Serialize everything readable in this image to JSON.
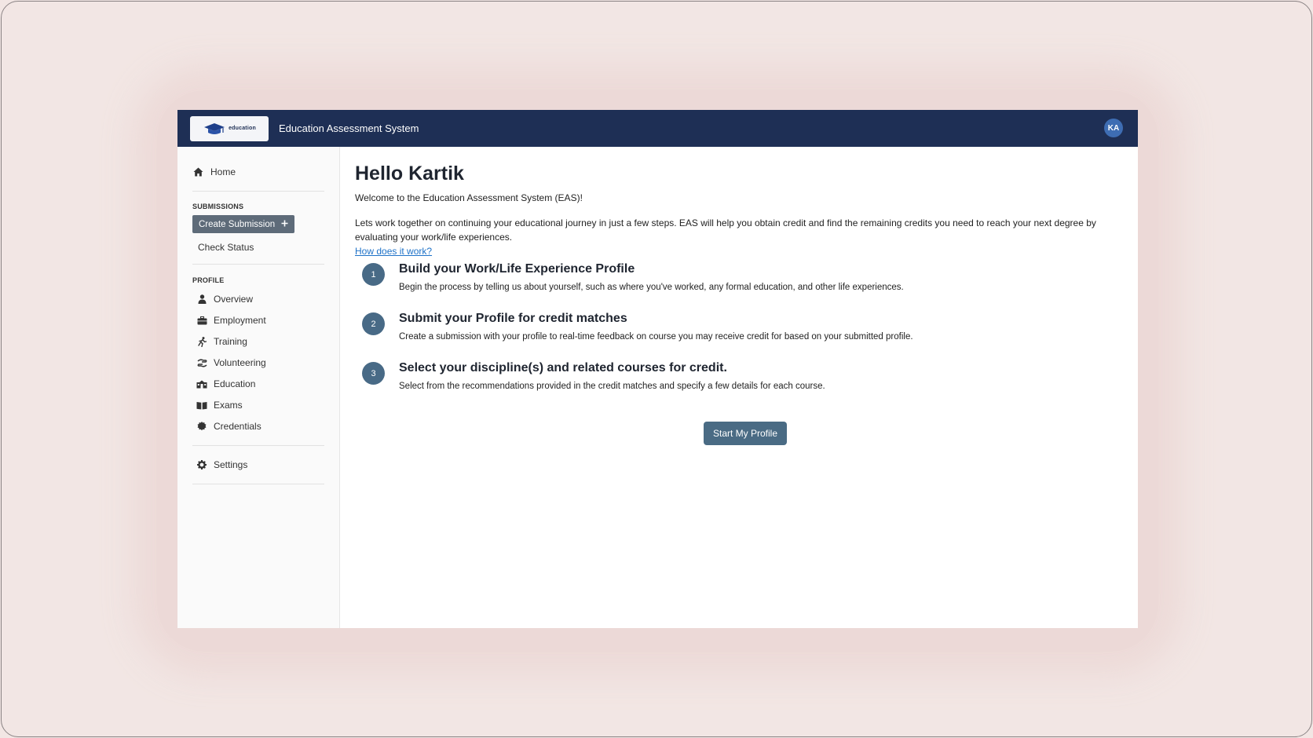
{
  "header": {
    "logo_text": "education",
    "app_title": "Education Assessment System",
    "avatar_initials": "KA"
  },
  "sidebar": {
    "home_label": "Home",
    "submissions_heading": "SUBMISSIONS",
    "create_submission_label": "Create Submission",
    "check_status_label": "Check Status",
    "profile_heading": "PROFILE",
    "profile_items": [
      {
        "label": "Overview",
        "icon": "user-icon"
      },
      {
        "label": "Employment",
        "icon": "briefcase-icon"
      },
      {
        "label": "Training",
        "icon": "running-person-icon"
      },
      {
        "label": "Volunteering",
        "icon": "hand-holding-icon"
      },
      {
        "label": "Education",
        "icon": "school-icon"
      },
      {
        "label": "Exams",
        "icon": "book-open-icon"
      },
      {
        "label": "Credentials",
        "icon": "certificate-icon"
      }
    ],
    "settings_label": "Settings"
  },
  "main": {
    "greeting": "Hello Kartik",
    "welcome": "Welcome to the Education Assessment System (EAS)!",
    "intro": "Lets work together on continuing your educational journey in just a few steps. EAS will help you obtain credit and find the remaining credits you need to reach your next degree by evaluating your work/life experiences.",
    "how_link": "How does it work?",
    "steps": [
      {
        "num": "1",
        "title": "Build your Work/Life Experience Profile",
        "desc": "Begin the process by telling us about yourself, such as where you've worked, any formal education, and other life experiences."
      },
      {
        "num": "2",
        "title": "Submit your Profile for credit matches",
        "desc": "Create a submission with your profile to real-time feedback on course you may receive credit for based on your submitted profile."
      },
      {
        "num": "3",
        "title": "Select your discipline(s) and related courses for credit.",
        "desc": "Select from the recommendations provided in the credit matches and specify a few details for each course."
      }
    ],
    "start_button": "Start My Profile"
  },
  "colors": {
    "header_bg": "#1e2f55",
    "step_circle": "#486a86",
    "primary_button": "#4a6b84",
    "create_button": "#5e6b79",
    "link": "#1e72c8",
    "avatar": "#3e6db3"
  }
}
